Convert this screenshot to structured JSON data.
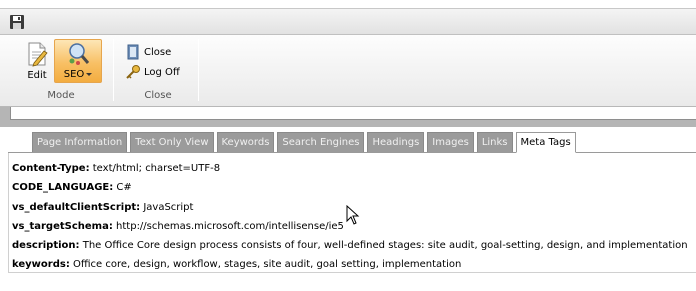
{
  "ribbon": {
    "mode_group": {
      "label": "Mode",
      "edit_label": "Edit",
      "seo_label": "SEO"
    },
    "close_group": {
      "label": "Close",
      "close_label": "Close",
      "logoff_label": "Log Off"
    }
  },
  "tabs": [
    {
      "label": "Page Information"
    },
    {
      "label": "Text Only View"
    },
    {
      "label": "Keywords"
    },
    {
      "label": "Search Engines"
    },
    {
      "label": "Headings"
    },
    {
      "label": "Images"
    },
    {
      "label": "Links"
    },
    {
      "label": "Meta Tags",
      "active": true
    }
  ],
  "meta_tags": [
    {
      "key": "Content-Type:",
      "value": " text/html; charset=UTF-8"
    },
    {
      "key": "CODE_LANGUAGE:",
      "value": " C#"
    },
    {
      "key": "vs_defaultClientScript:",
      "value": " JavaScript"
    },
    {
      "key": "vs_targetSchema:",
      "value": " http://schemas.microsoft.com/intellisense/ie5"
    },
    {
      "key": "description:",
      "value": " The Office Core design process consists of four, well-defined stages: site audit, goal-setting, design, and implementation"
    },
    {
      "key": "keywords:",
      "value": " Office core, design, workflow, stages, site audit, goal setting, implementation"
    }
  ],
  "colors": {
    "active_button": "#f8c065",
    "inactive_tab": "#9b9b9b"
  }
}
